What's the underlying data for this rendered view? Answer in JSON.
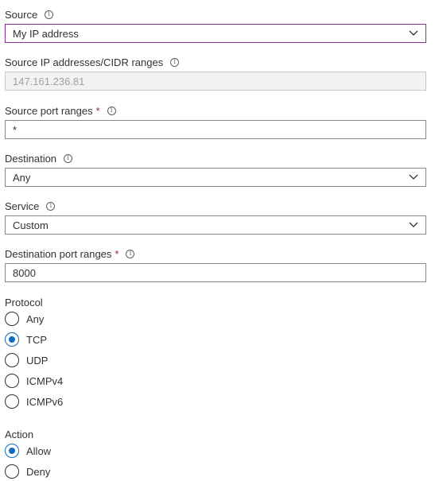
{
  "source": {
    "label": "Source",
    "value": "My IP address",
    "info_icon": "info-icon",
    "chevron_icon": "chevron-down-icon"
  },
  "source_ip": {
    "label": "Source IP addresses/CIDR ranges",
    "value": "147.161.236.81",
    "info_icon": "info-icon"
  },
  "source_port": {
    "label": "Source port ranges",
    "required_mark": "*",
    "value": "*",
    "info_icon": "info-icon"
  },
  "destination": {
    "label": "Destination",
    "value": "Any",
    "info_icon": "info-icon",
    "chevron_icon": "chevron-down-icon"
  },
  "service": {
    "label": "Service",
    "value": "Custom",
    "info_icon": "info-icon",
    "chevron_icon": "chevron-down-icon"
  },
  "destination_port": {
    "label": "Destination port ranges",
    "required_mark": "*",
    "value": "8000",
    "info_icon": "info-icon"
  },
  "protocol": {
    "label": "Protocol",
    "options": [
      "Any",
      "TCP",
      "UDP",
      "ICMPv4",
      "ICMPv6"
    ],
    "selected": "TCP"
  },
  "action": {
    "label": "Action",
    "options": [
      "Allow",
      "Deny"
    ],
    "selected": "Allow"
  },
  "colors": {
    "text": "#323130",
    "required": "#a4262c",
    "radio_accent": "#0f6cbd",
    "focus_border": "#8b2fa0",
    "disabled_bg": "#f3f2f1"
  }
}
